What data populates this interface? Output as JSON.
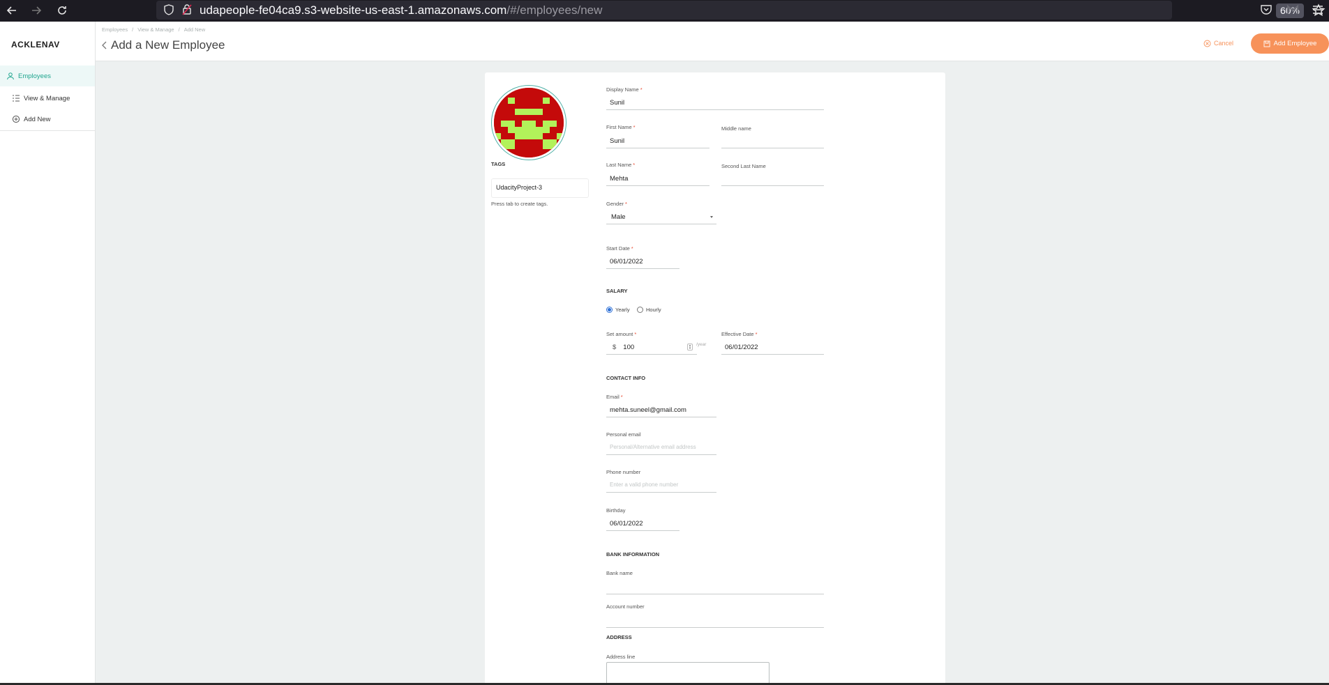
{
  "browser": {
    "url_host": "udapeople-fe04ca9.s3-website-us-east-1.amazonaws.com",
    "url_path": "/#/employees/new",
    "zoom": "60%"
  },
  "sidebar": {
    "brand": "ACKLENAV",
    "items": [
      {
        "label": "Employees",
        "icon": "user-icon",
        "active": true
      },
      {
        "label": "View & Manage",
        "icon": "list-icon",
        "active": false
      },
      {
        "label": "Add New",
        "icon": "plus-circle-icon",
        "active": false
      }
    ]
  },
  "header": {
    "breadcrumb": [
      "Employees",
      "/",
      "View & Manage",
      "/",
      "Add New"
    ],
    "title": "Add a New Employee",
    "cancel_label": "Cancel",
    "add_label": "Add Employee"
  },
  "profile": {
    "tags_label": "TAGS",
    "tag_value": "UdacityProject-3",
    "tags_hint": "Press tab to create tags."
  },
  "form": {
    "display_name": {
      "label": "Display Name",
      "value": "Sunil"
    },
    "first_name": {
      "label": "First Name",
      "value": "Sunil"
    },
    "middle_name": {
      "label": "Middle name",
      "value": ""
    },
    "last_name": {
      "label": "Last Name",
      "value": "Mehta"
    },
    "second_last_name": {
      "label": "Second Last Name",
      "value": ""
    },
    "gender": {
      "label": "Gender",
      "value": "Male"
    },
    "start_date": {
      "label": "Start Date",
      "value": "06/01/2022"
    },
    "salary": {
      "title": "SALARY",
      "option_yearly": "Yearly",
      "option_hourly": "Hourly",
      "amount_label": "Set amount",
      "currency": "$",
      "amount": "100",
      "per": "/year",
      "effective_label": "Effective Date",
      "effective_value": "06/01/2022"
    },
    "contact": {
      "title": "CONTACT INFO",
      "email_label": "Email",
      "email_value": "mehta.suneel@gmail.com",
      "personal_label": "Personal email",
      "personal_placeholder": "Personal/Alternative email address",
      "phone_label": "Phone number",
      "phone_placeholder": "Enter a valid phone number",
      "birthday_label": "Birthday",
      "birthday_value": "06/01/2022"
    },
    "bank": {
      "title": "BANK INFORMATION",
      "bank_label": "Bank name",
      "account_label": "Account number"
    },
    "address": {
      "title": "ADDRESS",
      "line_label": "Address line"
    }
  },
  "colors": {
    "accent": "#f7925a",
    "active_green": "#1fa58e",
    "required": "#e8482e",
    "avatar_red": "#c40a0a",
    "avatar_green": "#b2f25a"
  }
}
